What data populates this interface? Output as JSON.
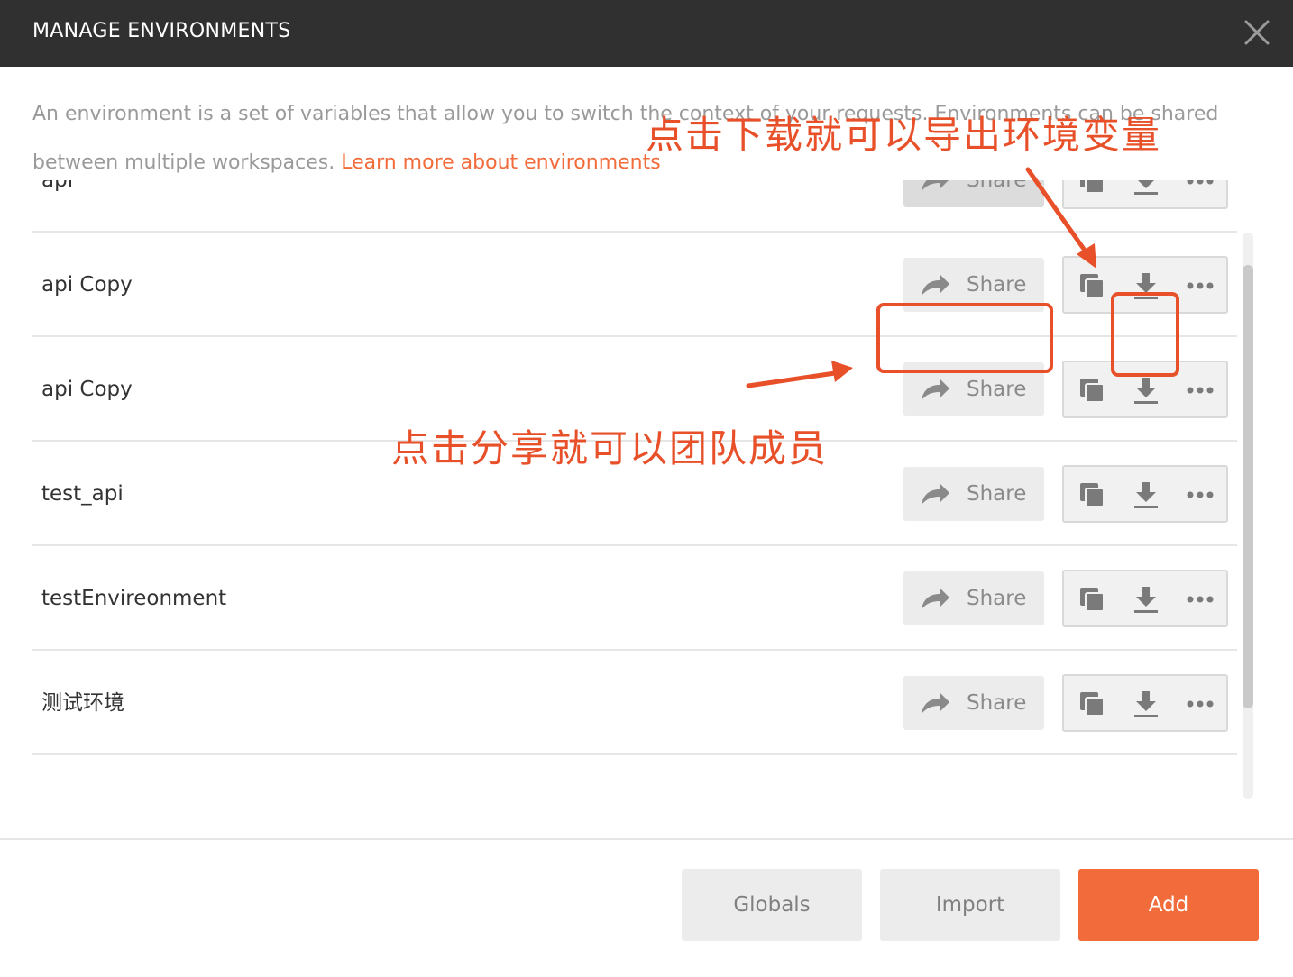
{
  "dialog": {
    "title": "MANAGE ENVIRONMENTS",
    "description": "An environment is a set of variables that allow you to switch the context of your requests. Environments can be shared between multiple workspaces.",
    "learn_more_link": "Learn more about environments"
  },
  "environments": [
    {
      "name": "api",
      "share_label": "Share"
    },
    {
      "name": "api Copy",
      "share_label": "Share"
    },
    {
      "name": "api Copy",
      "share_label": "Share"
    },
    {
      "name": "test_api",
      "share_label": "Share"
    },
    {
      "name": "testEnvireonment",
      "share_label": "Share"
    },
    {
      "name": "测试环境",
      "share_label": "Share"
    }
  ],
  "footer": {
    "globals_label": "Globals",
    "import_label": "Import",
    "add_label": "Add"
  },
  "annotations": {
    "download_note": "点击下载就可以导出环境变量",
    "share_note": "点击分享就可以团队成员"
  },
  "colors": {
    "accent": "#f26b3a",
    "annotation": "#e8502a",
    "titlebar": "#303030"
  },
  "icons": [
    "close-icon",
    "share-icon",
    "duplicate-icon",
    "download-icon",
    "more-icon"
  ]
}
